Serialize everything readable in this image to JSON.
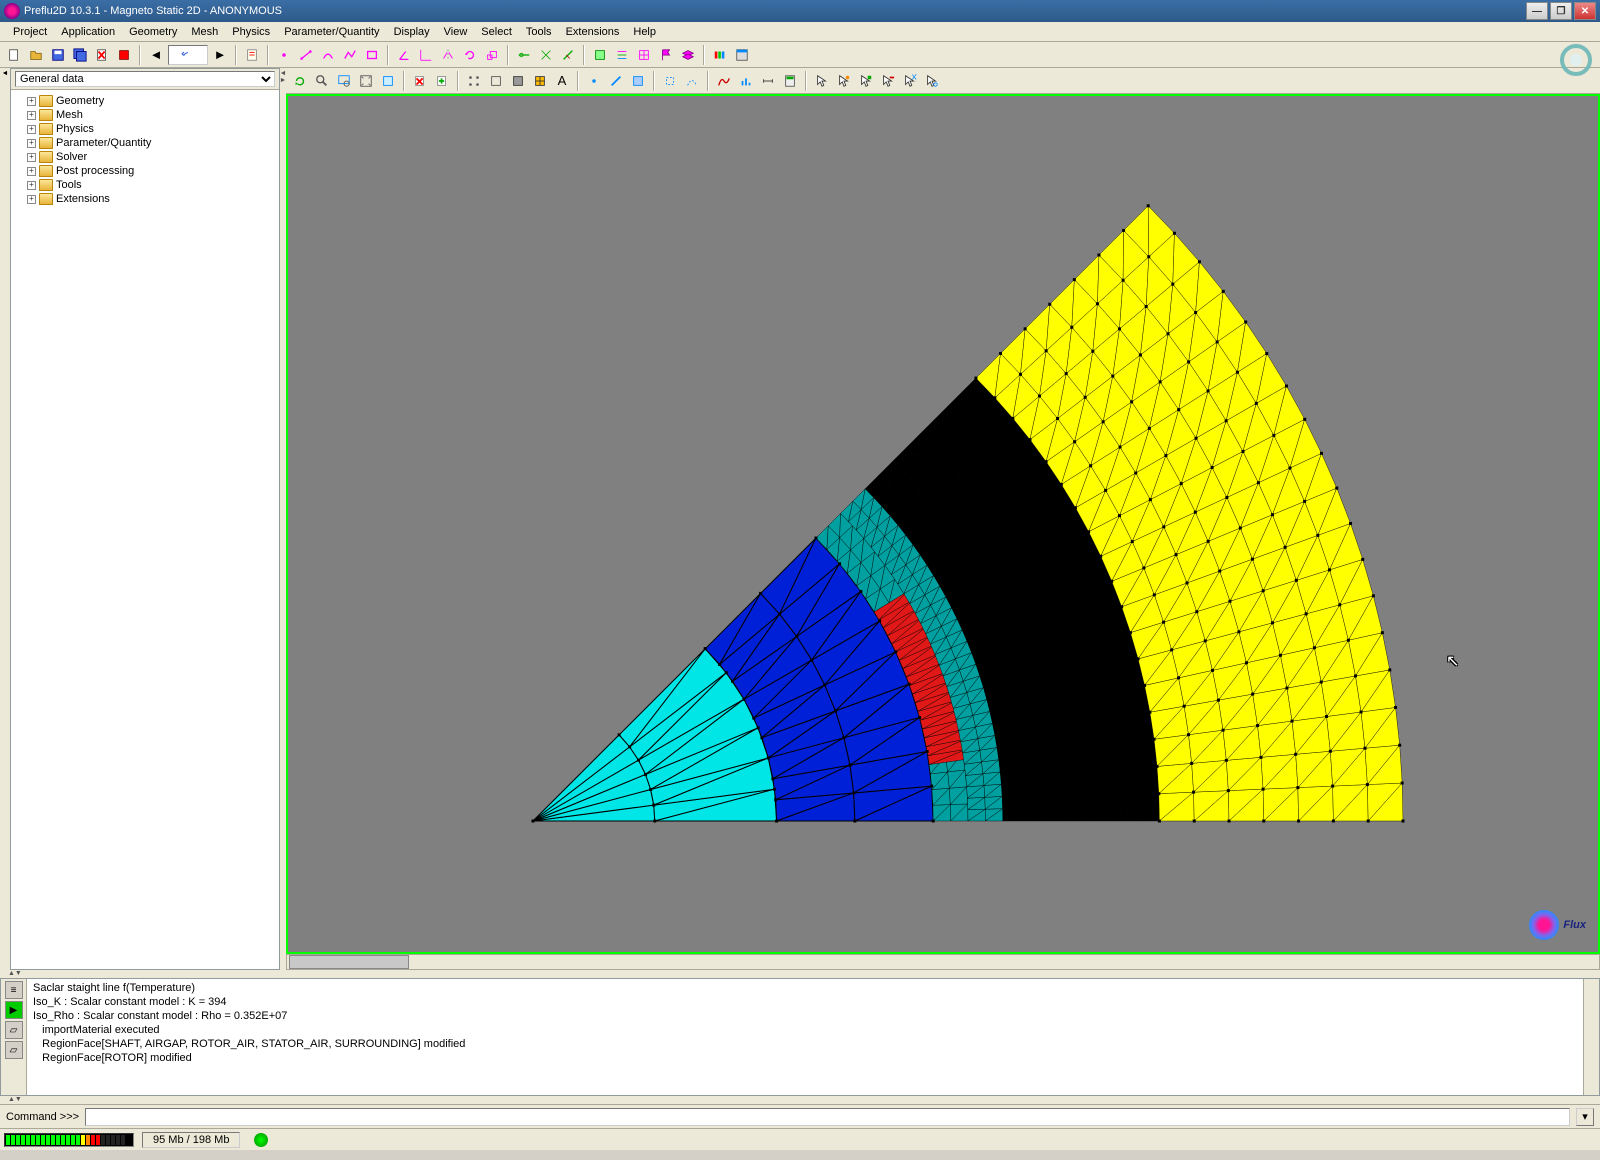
{
  "window": {
    "title": "Preflu2D 10.3.1 - Magneto Static 2D - ANONYMOUS"
  },
  "menu": {
    "items": [
      "Project",
      "Application",
      "Geometry",
      "Mesh",
      "Physics",
      "Parameter/Quantity",
      "Display",
      "View",
      "Select",
      "Tools",
      "Extensions",
      "Help"
    ]
  },
  "sidebar": {
    "dropdown": "General data",
    "tree": [
      {
        "label": "Geometry"
      },
      {
        "label": "Mesh"
      },
      {
        "label": "Physics"
      },
      {
        "label": "Parameter/Quantity"
      },
      {
        "label": "Solver"
      },
      {
        "label": "Post processing"
      },
      {
        "label": "Tools"
      },
      {
        "label": "Extensions"
      }
    ]
  },
  "console": {
    "lines": [
      "Saclar staight line f(Temperature)",
      "Iso_K : Scalar constant model : K = 394",
      "Iso_Rho : Scalar constant model : Rho = 0.352E+07",
      "   importMaterial executed",
      "   RegionFace[SHAFT, AIRGAP, ROTOR_AIR, STATOR_AIR, SURROUNDING] modified",
      "   RegionFace[ROTOR] modified"
    ]
  },
  "command": {
    "label": "Command >>>",
    "value": ""
  },
  "status": {
    "memory": "95 Mb / 198 Mb"
  },
  "viewport": {
    "logo_text": "Flux"
  },
  "colors": {
    "shaft": "#00e5e5",
    "rotor": "#0020d8",
    "magnet": "#e01818",
    "stator": "#ffff00",
    "airgap_dark": "#00a0a0",
    "iron": "#000000"
  }
}
